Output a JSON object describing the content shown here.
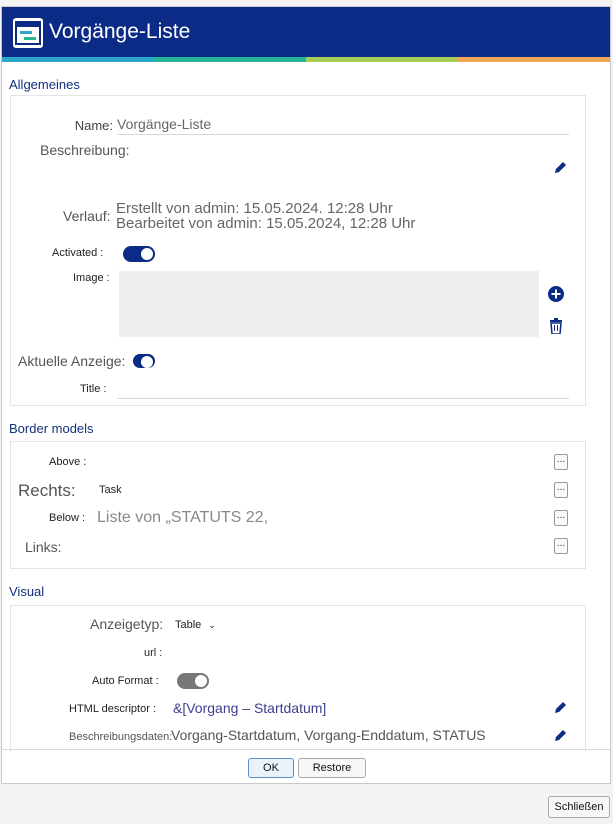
{
  "window": {
    "title": "Vorgänge-Liste",
    "stripe_colors": [
      "#2aa7c9",
      "#27b59a",
      "#a7cc55",
      "#f0a557"
    ]
  },
  "sections": {
    "general": {
      "title": "Allgemeines",
      "name_label": "Name:",
      "name_value": "Vorgänge-Liste",
      "description_label": "Beschreibung:",
      "history_label": "Verlauf:",
      "created": "Erstellt von admin: 15.05.2024. 12:28 Uhr",
      "edited": "Bearbeitet von admin: 15.05.2024, 12:28 Uhr",
      "activated_label": "Activated :",
      "image_label": "Image :",
      "current_display_label": "Aktuelle Anzeige:",
      "title_label": "Title :"
    },
    "border": {
      "title": "Border models",
      "above_label": "Above :",
      "right_label": "Rechts:",
      "right_value": "Task",
      "below_label": "Below :",
      "below_value": "Liste von „STATUTS 22,",
      "left_label": "Links:",
      "dots": "..."
    },
    "visual": {
      "title": "Visual",
      "display_type_label": "Anzeigetyp:",
      "display_type_value": "Table",
      "url_label": "url :",
      "auto_format_label": "Auto Format :",
      "html_label": "HTML descriptor :",
      "html_value": "&[Vorgang – Startdatum]",
      "desc_data_label": "Beschreibungsdaten:",
      "desc_data_value": "Vorgang-Startdatum, Vorgang-Enddatum, STATUS"
    }
  },
  "buttons": {
    "ok": "OK",
    "restore": "Restore",
    "close": "Schließen"
  }
}
